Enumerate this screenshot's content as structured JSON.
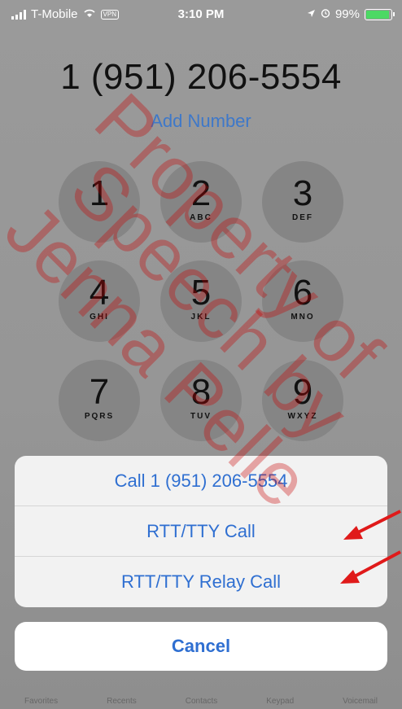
{
  "status_bar": {
    "carrier": "T-Mobile",
    "vpn": "VPN",
    "time": "3:10 PM",
    "battery_pct": "99%",
    "battery_level": 0.99
  },
  "dialer": {
    "number": "1 (951) 206-5554",
    "add_number": "Add Number"
  },
  "keys": [
    {
      "digit": "1",
      "letters": ""
    },
    {
      "digit": "2",
      "letters": "ABC"
    },
    {
      "digit": "3",
      "letters": "DEF"
    },
    {
      "digit": "4",
      "letters": "GHI"
    },
    {
      "digit": "5",
      "letters": "JKL"
    },
    {
      "digit": "6",
      "letters": "MNO"
    },
    {
      "digit": "7",
      "letters": "PQRS"
    },
    {
      "digit": "8",
      "letters": "TUV"
    },
    {
      "digit": "9",
      "letters": "WXYZ"
    }
  ],
  "action_sheet": {
    "options": [
      "Call 1 (951) 206-5554",
      "RTT/TTY Call",
      "RTT/TTY Relay Call"
    ],
    "cancel": "Cancel"
  },
  "tab_bar": {
    "items": [
      "Favorites",
      "Recents",
      "Contacts",
      "Keypad",
      "Voicemail"
    ]
  },
  "watermark": {
    "line1": "Property of",
    "line2": "Speech by",
    "line3": "Jenna Pelle"
  },
  "annotation": {
    "arrow_color": "#e01a1a"
  }
}
